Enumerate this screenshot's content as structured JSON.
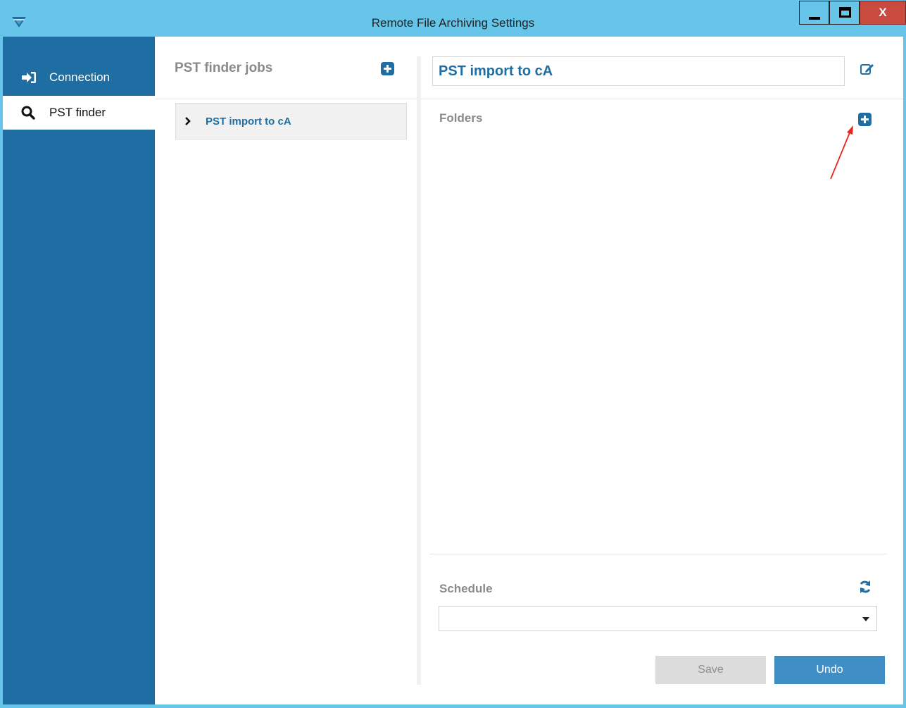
{
  "window": {
    "title": "Remote File Archiving Settings",
    "close_label": "X"
  },
  "sidebar": {
    "items": [
      {
        "label": "Connection",
        "icon": "sign-in-icon",
        "active": false
      },
      {
        "label": "PST finder",
        "icon": "search-icon",
        "active": true
      }
    ]
  },
  "jobs": {
    "header": "PST finder jobs",
    "items": [
      {
        "label": "PST import to cA"
      }
    ]
  },
  "details": {
    "job_name": "PST import to cA",
    "folders_label": "Folders",
    "schedule_label": "Schedule",
    "schedule_value": "",
    "save_label": "Save",
    "undo_label": "Undo"
  },
  "colors": {
    "titlebar": "#66c5e8",
    "sidebar": "#1f6ea3",
    "accent": "#1f6ea3",
    "undo_button": "#3f8fc6",
    "save_button_disabled": "#dcdcdc",
    "close_button": "#c94b3f",
    "annotation_arrow": "#e8261c"
  }
}
